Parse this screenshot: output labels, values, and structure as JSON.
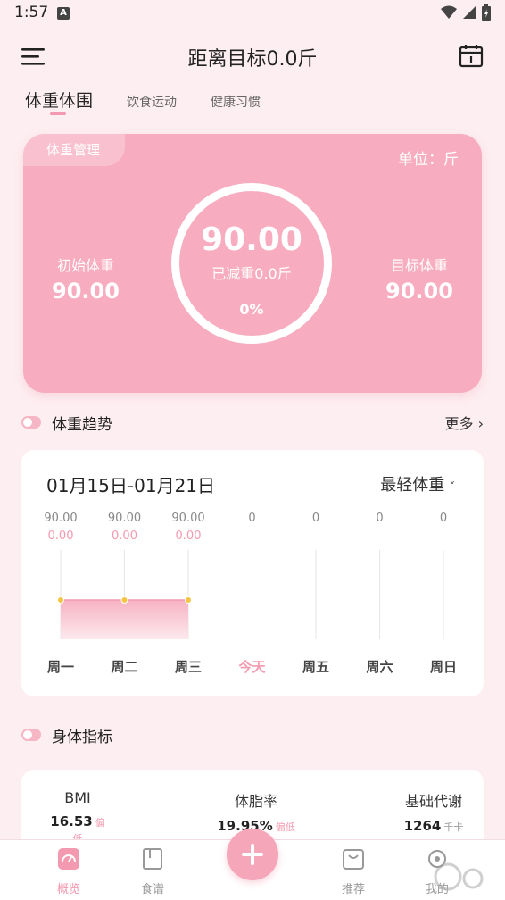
{
  "status_bar": {
    "time": "1:57",
    "notif_icon": "A"
  },
  "header": {
    "title": "距离目标0.0斤"
  },
  "tabs": [
    {
      "label": "体重体围",
      "active": true
    },
    {
      "label": "饮食运动",
      "active": false
    },
    {
      "label": "健康习惯",
      "active": false
    }
  ],
  "weight_card": {
    "tag": "体重管理",
    "unit": "单位：斤",
    "start_label": "初始体重",
    "start_value": "90.00",
    "current_value": "90.00",
    "lost_text": "已减重0.0斤",
    "progress": "0%",
    "target_label": "目标体重",
    "target_value": "90.00"
  },
  "trend": {
    "section_title": "体重趋势",
    "more": "更多",
    "range": "01月15日-01月21日",
    "mode": "最轻体重",
    "chart_data": {
      "type": "area",
      "categories": [
        "周一",
        "周二",
        "周三",
        "今天",
        "周五",
        "周六",
        "周日"
      ],
      "weights": [
        "90.00",
        "90.00",
        "90.00",
        "0",
        "0",
        "0",
        "0"
      ],
      "changes": [
        "0.00",
        "0.00",
        "0.00",
        "",
        "",
        "",
        ""
      ],
      "values": [
        90,
        90,
        90,
        null,
        null,
        null,
        null
      ],
      "highlight_index": 3
    }
  },
  "indicators": {
    "section_title": "身体指标",
    "items": [
      {
        "label": "BMI",
        "value": "16.53",
        "note": "偏低"
      },
      {
        "label": "体脂率",
        "value": "19.95%",
        "note": "偏低"
      },
      {
        "label": "基础代谢",
        "value": "1264",
        "note": "千卡"
      }
    ]
  },
  "bottom_nav": [
    {
      "label": "概览",
      "icon": "overview-icon",
      "active": true
    },
    {
      "label": "食谱",
      "icon": "recipe-icon",
      "active": false
    },
    {
      "label": "推荐",
      "icon": "recommend-icon",
      "active": false
    },
    {
      "label": "我的",
      "icon": "profile-icon",
      "active": false
    }
  ],
  "colors": {
    "accent": "#f39ab0",
    "card": "#f7adbf",
    "background": "#fdeef1"
  }
}
